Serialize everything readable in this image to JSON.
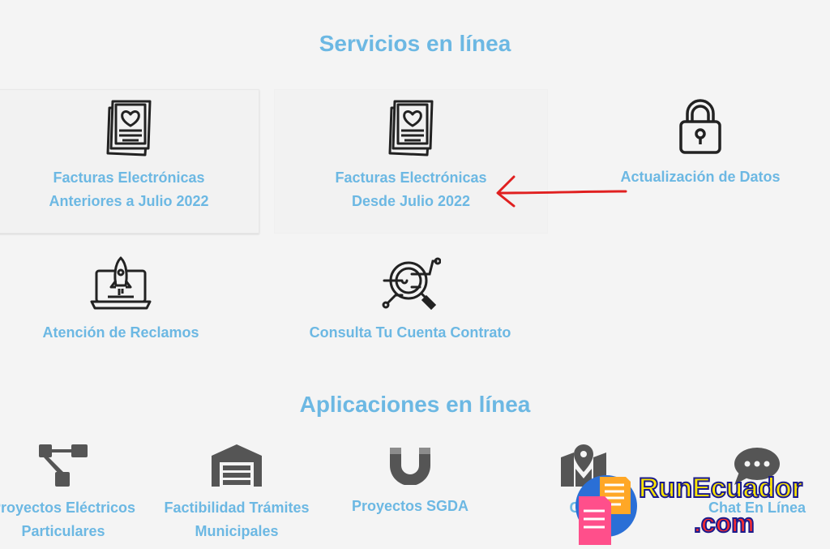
{
  "sections": {
    "services_title": "Servicios en línea",
    "apps_title": "Aplicaciones en línea"
  },
  "services": [
    {
      "label": "Facturas Electrónicas\nAnteriores a Julio 2022",
      "icon": "invoice-heart-icon"
    },
    {
      "label": "Facturas Electrónicas\nDesde Julio 2022",
      "icon": "invoice-heart-icon"
    },
    {
      "label": "Actualización de Datos",
      "icon": "padlock-icon"
    },
    {
      "label": "Atención de Reclamos",
      "icon": "laptop-rocket-icon"
    },
    {
      "label": "Consulta Tu Cuenta Contrato",
      "icon": "magnifier-circuit-icon"
    }
  ],
  "apps": [
    {
      "label": "Proyectos Eléctricos\nParticulares",
      "icon": "sitemap-icon"
    },
    {
      "label": "Factibilidad Trámites\nMunicipales",
      "icon": "warehouse-icon"
    },
    {
      "label": "Proyectos SGDA",
      "icon": "magnet-icon"
    },
    {
      "label": "Geo",
      "icon": "map-pin-icon"
    },
    {
      "label": "Chat En Línea",
      "icon": "chat-bubble-icon"
    }
  ],
  "watermark": {
    "name": "RunEcuador",
    "domain": ".com"
  },
  "colors": {
    "accent": "#6cb8e3",
    "icon": "#222222",
    "app_icon": "#555555",
    "arrow": "#e02020"
  }
}
